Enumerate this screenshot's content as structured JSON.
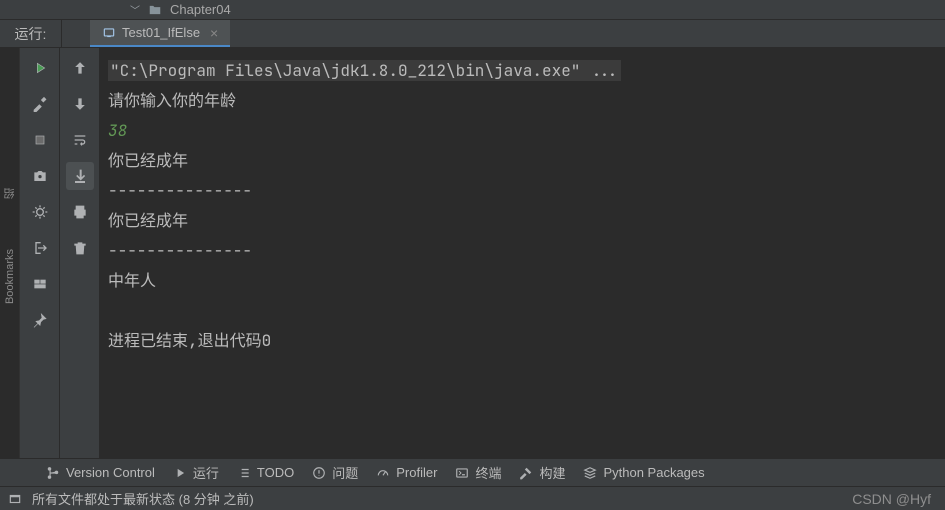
{
  "breadcrumb": {
    "item": "Chapter04"
  },
  "run": {
    "label": "运行:",
    "tab_title": "Test01_IfElse"
  },
  "console": {
    "cmd": "\"C:\\Program Files\\Java\\jdk1.8.0_212\\bin\\java.exe\" ...",
    "lines": [
      "请你输入你的年龄",
      "38",
      "你已经成年",
      "---------------",
      "你已经成年",
      "---------------",
      "中年人",
      "",
      "进程已结束,退出代码0"
    ]
  },
  "sidetabs": {
    "t0": "绍",
    "t1": "Bookmarks"
  },
  "bottom": {
    "vcs": "Version Control",
    "run": "运行",
    "todo": "TODO",
    "problems": "问题",
    "profiler": "Profiler",
    "terminal": "终端",
    "build": "构建",
    "pypkg": "Python Packages"
  },
  "status": {
    "text": "所有文件都处于最新状态 (8 分钟 之前)",
    "watermark": "CSDN @Hyf"
  }
}
